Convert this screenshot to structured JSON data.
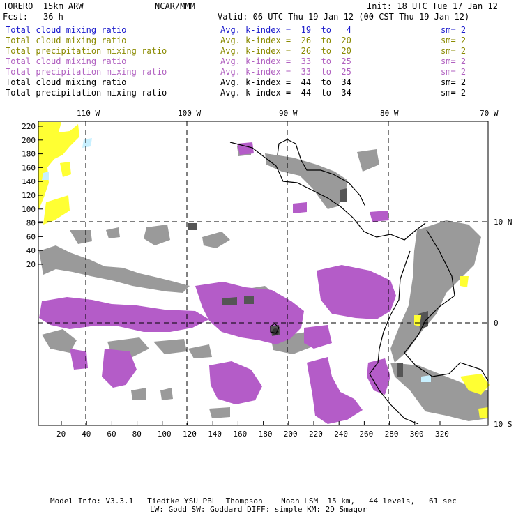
{
  "header": {
    "model": "TORERO  15km ARW",
    "center": "NCAR/MMM",
    "init": "Init: 18 UTC Tue 17 Jan 12",
    "fcst_label": "Fcst:",
    "fcst_value": "36 h",
    "valid": "Valid: 06 UTC Thu 19 Jan 12 (00 CST Thu 19 Jan 12)"
  },
  "legend": [
    {
      "field": "Total cloud mixing ratio",
      "kindex": "Avg. k-index =  19  to   4",
      "sm": "sm= 2",
      "color": "#1a1acc"
    },
    {
      "field": "Total cloud mixing ratio",
      "kindex": "Avg. k-index =  26  to  20",
      "sm": "sm= 2",
      "color": "#8a8a00"
    },
    {
      "field": "Total precipitation mixing ratio",
      "kindex": "Avg. k-index =  26  to  20",
      "sm": "sm= 2",
      "color": "#8a8a00"
    },
    {
      "field": "Total cloud mixing ratio",
      "kindex": "Avg. k-index =  33  to  25",
      "sm": "sm= 2",
      "color": "#b060c0"
    },
    {
      "field": "Total precipitation mixing ratio",
      "kindex": "Avg. k-index =  33  to  25",
      "sm": "sm= 2",
      "color": "#b060c0"
    },
    {
      "field": "Total cloud mixing ratio",
      "kindex": "Avg. k-index =  44  to  34",
      "sm": "sm= 2",
      "color": "#000000"
    },
    {
      "field": "Total precipitation mixing ratio",
      "kindex": "Avg. k-index =  44  to  34",
      "sm": "sm= 2",
      "color": "#000000"
    }
  ],
  "map": {
    "lon_labels": [
      "110 W",
      "100 W",
      "90 W",
      "80 W",
      "70 W"
    ],
    "lat_labels": [
      "10 N",
      "0",
      "10 S"
    ],
    "x_ticks": [
      "20",
      "40",
      "60",
      "80",
      "100",
      "120",
      "140",
      "160",
      "180",
      "200",
      "220",
      "240",
      "260",
      "280",
      "300",
      "320"
    ],
    "y_ticks": [
      "220",
      "200",
      "180",
      "160",
      "140",
      "120",
      "100",
      "80",
      "60",
      "40",
      "20"
    ],
    "colors": {
      "gray": "#9a9a9a",
      "dark": "#555555",
      "violet": "#b45cc8",
      "yellow": "#ffff33",
      "cyan": "#c8f0ff",
      "coast": "#000000"
    }
  },
  "footer": {
    "line1": "Model Info: V3.3.1   Tiedtke YSU PBL  Thompson    Noah LSM  15 km,   44 levels,   61 sec",
    "line2": "LW: Godd SW: Goddard DIFF: simple KM: 2D Smagor"
  }
}
